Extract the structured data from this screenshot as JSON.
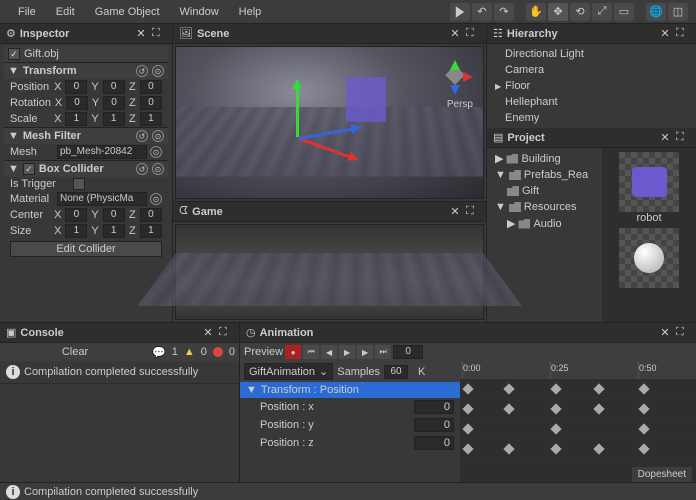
{
  "menu": {
    "file": "File",
    "edit": "Edit",
    "gameobject": "Game Object",
    "window": "Window",
    "help": "Help"
  },
  "inspector": {
    "title": "Inspector",
    "object_name": "Gift.obj",
    "components": {
      "transform": {
        "title": "Transform",
        "position": {
          "label": "Position",
          "x": "0",
          "y": "0",
          "z": "0"
        },
        "rotation": {
          "label": "Rotation",
          "x": "0",
          "y": "0",
          "z": "0"
        },
        "scale": {
          "label": "Scale",
          "x": "1",
          "y": "1",
          "z": "1"
        }
      },
      "mesh_filter": {
        "title": "Mesh Filter",
        "mesh_label": "Mesh",
        "mesh_value": "pb_Mesh-20842"
      },
      "box_collider": {
        "title": "Box Collider",
        "is_trigger": {
          "label": "Is Trigger",
          "checked": false
        },
        "material": {
          "label": "Material",
          "value": "None (PhysicMa"
        },
        "center": {
          "label": "Center",
          "x": "0",
          "y": "0",
          "z": "0"
        },
        "size": {
          "label": "Size",
          "x": "1",
          "y": "1",
          "z": "1"
        },
        "edit_btn": "Edit Collider"
      }
    }
  },
  "scene": {
    "title": "Scene",
    "persp": "Persp"
  },
  "game": {
    "title": "Game"
  },
  "hierarchy": {
    "title": "Hierarchy",
    "items": [
      {
        "name": "Directional Light",
        "expandable": false
      },
      {
        "name": "Camera",
        "expandable": false
      },
      {
        "name": "Floor",
        "expandable": true
      },
      {
        "name": "Hellephant",
        "expandable": false
      },
      {
        "name": "Enemy",
        "expandable": false
      }
    ]
  },
  "project": {
    "title": "Project",
    "tree": [
      {
        "name": "Building",
        "exp": true,
        "indent": 0
      },
      {
        "name": "Prefabs_Rea",
        "exp": false,
        "open": true,
        "indent": 0
      },
      {
        "name": "Gift",
        "indent": 1
      },
      {
        "name": "Resources",
        "exp": false,
        "open": true,
        "indent": 0
      },
      {
        "name": "Audio",
        "exp": true,
        "indent": 1
      }
    ],
    "assets": [
      {
        "name": "robot"
      }
    ]
  },
  "console": {
    "title": "Console",
    "clear": "Clear",
    "counts": {
      "info": "1",
      "warn": "0",
      "error": "0"
    },
    "message": "Compilation completed successfully"
  },
  "animation": {
    "title": "Animation",
    "preview": "Preview",
    "frame": "0",
    "clip": "GiftAnimation",
    "samples_label": "Samples",
    "samples_value": "60",
    "k": "K",
    "track_header": "Transform : Position",
    "props": [
      {
        "name": "Position : x",
        "value": "0"
      },
      {
        "name": "Position : y",
        "value": "0"
      },
      {
        "name": "Position : z",
        "value": "0"
      }
    ],
    "ticks": [
      "0:00",
      "0:25",
      "0:50"
    ],
    "dopesheet": "Dopesheet"
  },
  "axis": {
    "x": "X",
    "y": "Y",
    "z": "Z"
  },
  "status": {
    "message": "Compilation completed successfully"
  }
}
